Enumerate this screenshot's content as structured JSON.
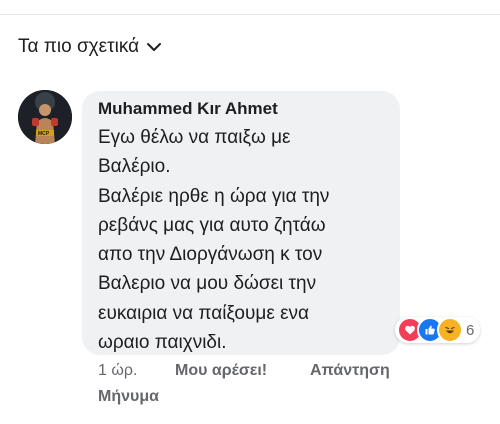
{
  "sort": {
    "label": "Τα πιο σχετικά"
  },
  "comment": {
    "author": "Muhammed Kır Ahmet",
    "lines": [
      "Εγω θέλω να παιξω με",
      "Βαλέριο.",
      "Βαλέριε ηρθε η ώρα για την",
      "ρεβάνς μας για αυτο ζητάω",
      "απο την Διοργάνωση κ τον",
      "Βαλεριο να μου δώσει την",
      "ευκαιρια να παίξουμε ενα",
      "ωραιο παιχνιδι."
    ],
    "reactions": {
      "icons": [
        "love-icon",
        "like-icon",
        "haha-icon"
      ],
      "count": "6"
    },
    "time": "1 ώρ.",
    "like_label": "Μου αρέσει!",
    "reply_label": "Απάντηση",
    "message_label": "Μήνυμα"
  },
  "colors": {
    "like": "#1877f2",
    "love": "#f33e58",
    "haha": "#f7b125",
    "bubble": "#eff1f3",
    "meta": "#65676b"
  }
}
